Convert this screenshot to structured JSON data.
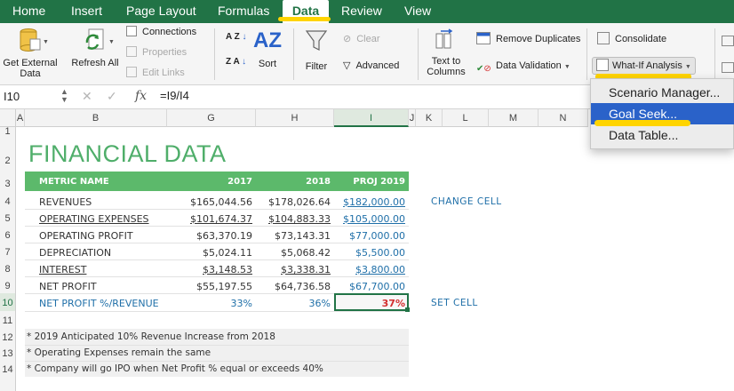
{
  "tabs": [
    "Home",
    "Insert",
    "Page Layout",
    "Formulas",
    "Data",
    "Review",
    "View"
  ],
  "ribbon": {
    "get_external_data": "Get External Data",
    "refresh_all": "Refresh All",
    "connections": "Connections",
    "properties": "Properties",
    "edit_links": "Edit Links",
    "sort_az": "A Z",
    "sort_za": "Z A",
    "sort": "Sort",
    "filter": "Filter",
    "clear": "Clear",
    "advanced": "Advanced",
    "text_to_columns": "Text to Columns",
    "remove_duplicates": "Remove Duplicates",
    "data_validation": "Data Validation",
    "consolidate": "Consolidate",
    "what_if": "What-If Analysis"
  },
  "formula_bar": {
    "name_box": "I10",
    "fx": "fx",
    "formula": "=I9/I4"
  },
  "columns": [
    "A",
    "B",
    "G",
    "H",
    "I",
    "J",
    "K",
    "L",
    "M",
    "N"
  ],
  "rows": [
    "1",
    "2",
    "3",
    "4",
    "5",
    "6",
    "7",
    "8",
    "9",
    "10",
    "11",
    "12",
    "13",
    "14"
  ],
  "sheet": {
    "title": "FINANCIAL DATA",
    "header": [
      "METRIC NAME",
      "2017",
      "2018",
      "PROJ 2019"
    ],
    "data_rows": [
      {
        "metric": "REVENUES",
        "y2017": "$165,044.56",
        "y2018": "$178,026.64",
        "proj": "$182,000.00"
      },
      {
        "metric": "OPERATING EXPENSES",
        "y2017": "$101,674.37",
        "y2018": "$104,883.33",
        "proj": "$105,000.00"
      },
      {
        "metric": "OPERATING PROFIT",
        "y2017": "$63,370.19",
        "y2018": "$73,143.31",
        "proj": "$77,000.00"
      },
      {
        "metric": "DEPRECIATION",
        "y2017": "$5,024.11",
        "y2018": "$5,068.42",
        "proj": "$5,500.00"
      },
      {
        "metric": "INTEREST",
        "y2017": "$3,148.53",
        "y2018": "$3,338.31",
        "proj": "$3,800.00"
      },
      {
        "metric": "NET PROFIT",
        "y2017": "$55,197.55",
        "y2018": "$64,736.58",
        "proj": "$67,700.00"
      },
      {
        "metric": "NET PROFIT %/REVENUE",
        "y2017": "33%",
        "y2018": "36%",
        "proj": "37%"
      }
    ],
    "change_cell": "CHANGE CELL",
    "set_cell": "SET CELL",
    "notes": [
      "* 2019 Anticipated 10% Revenue Increase from 2018",
      "* Operating Expenses remain the same",
      "* Company will go IPO when Net Profit % equal or exceeds 40%"
    ]
  },
  "whatif_menu": [
    "Scenario Manager...",
    "Goal Seek...",
    "Data Table..."
  ],
  "colors": {
    "excel_green": "#217346",
    "header_green": "#5cb96b",
    "title_green": "#4fae6a",
    "highlight": "#ffd400",
    "menu_active": "#2a62c9",
    "negative_red": "#d32f2f"
  }
}
